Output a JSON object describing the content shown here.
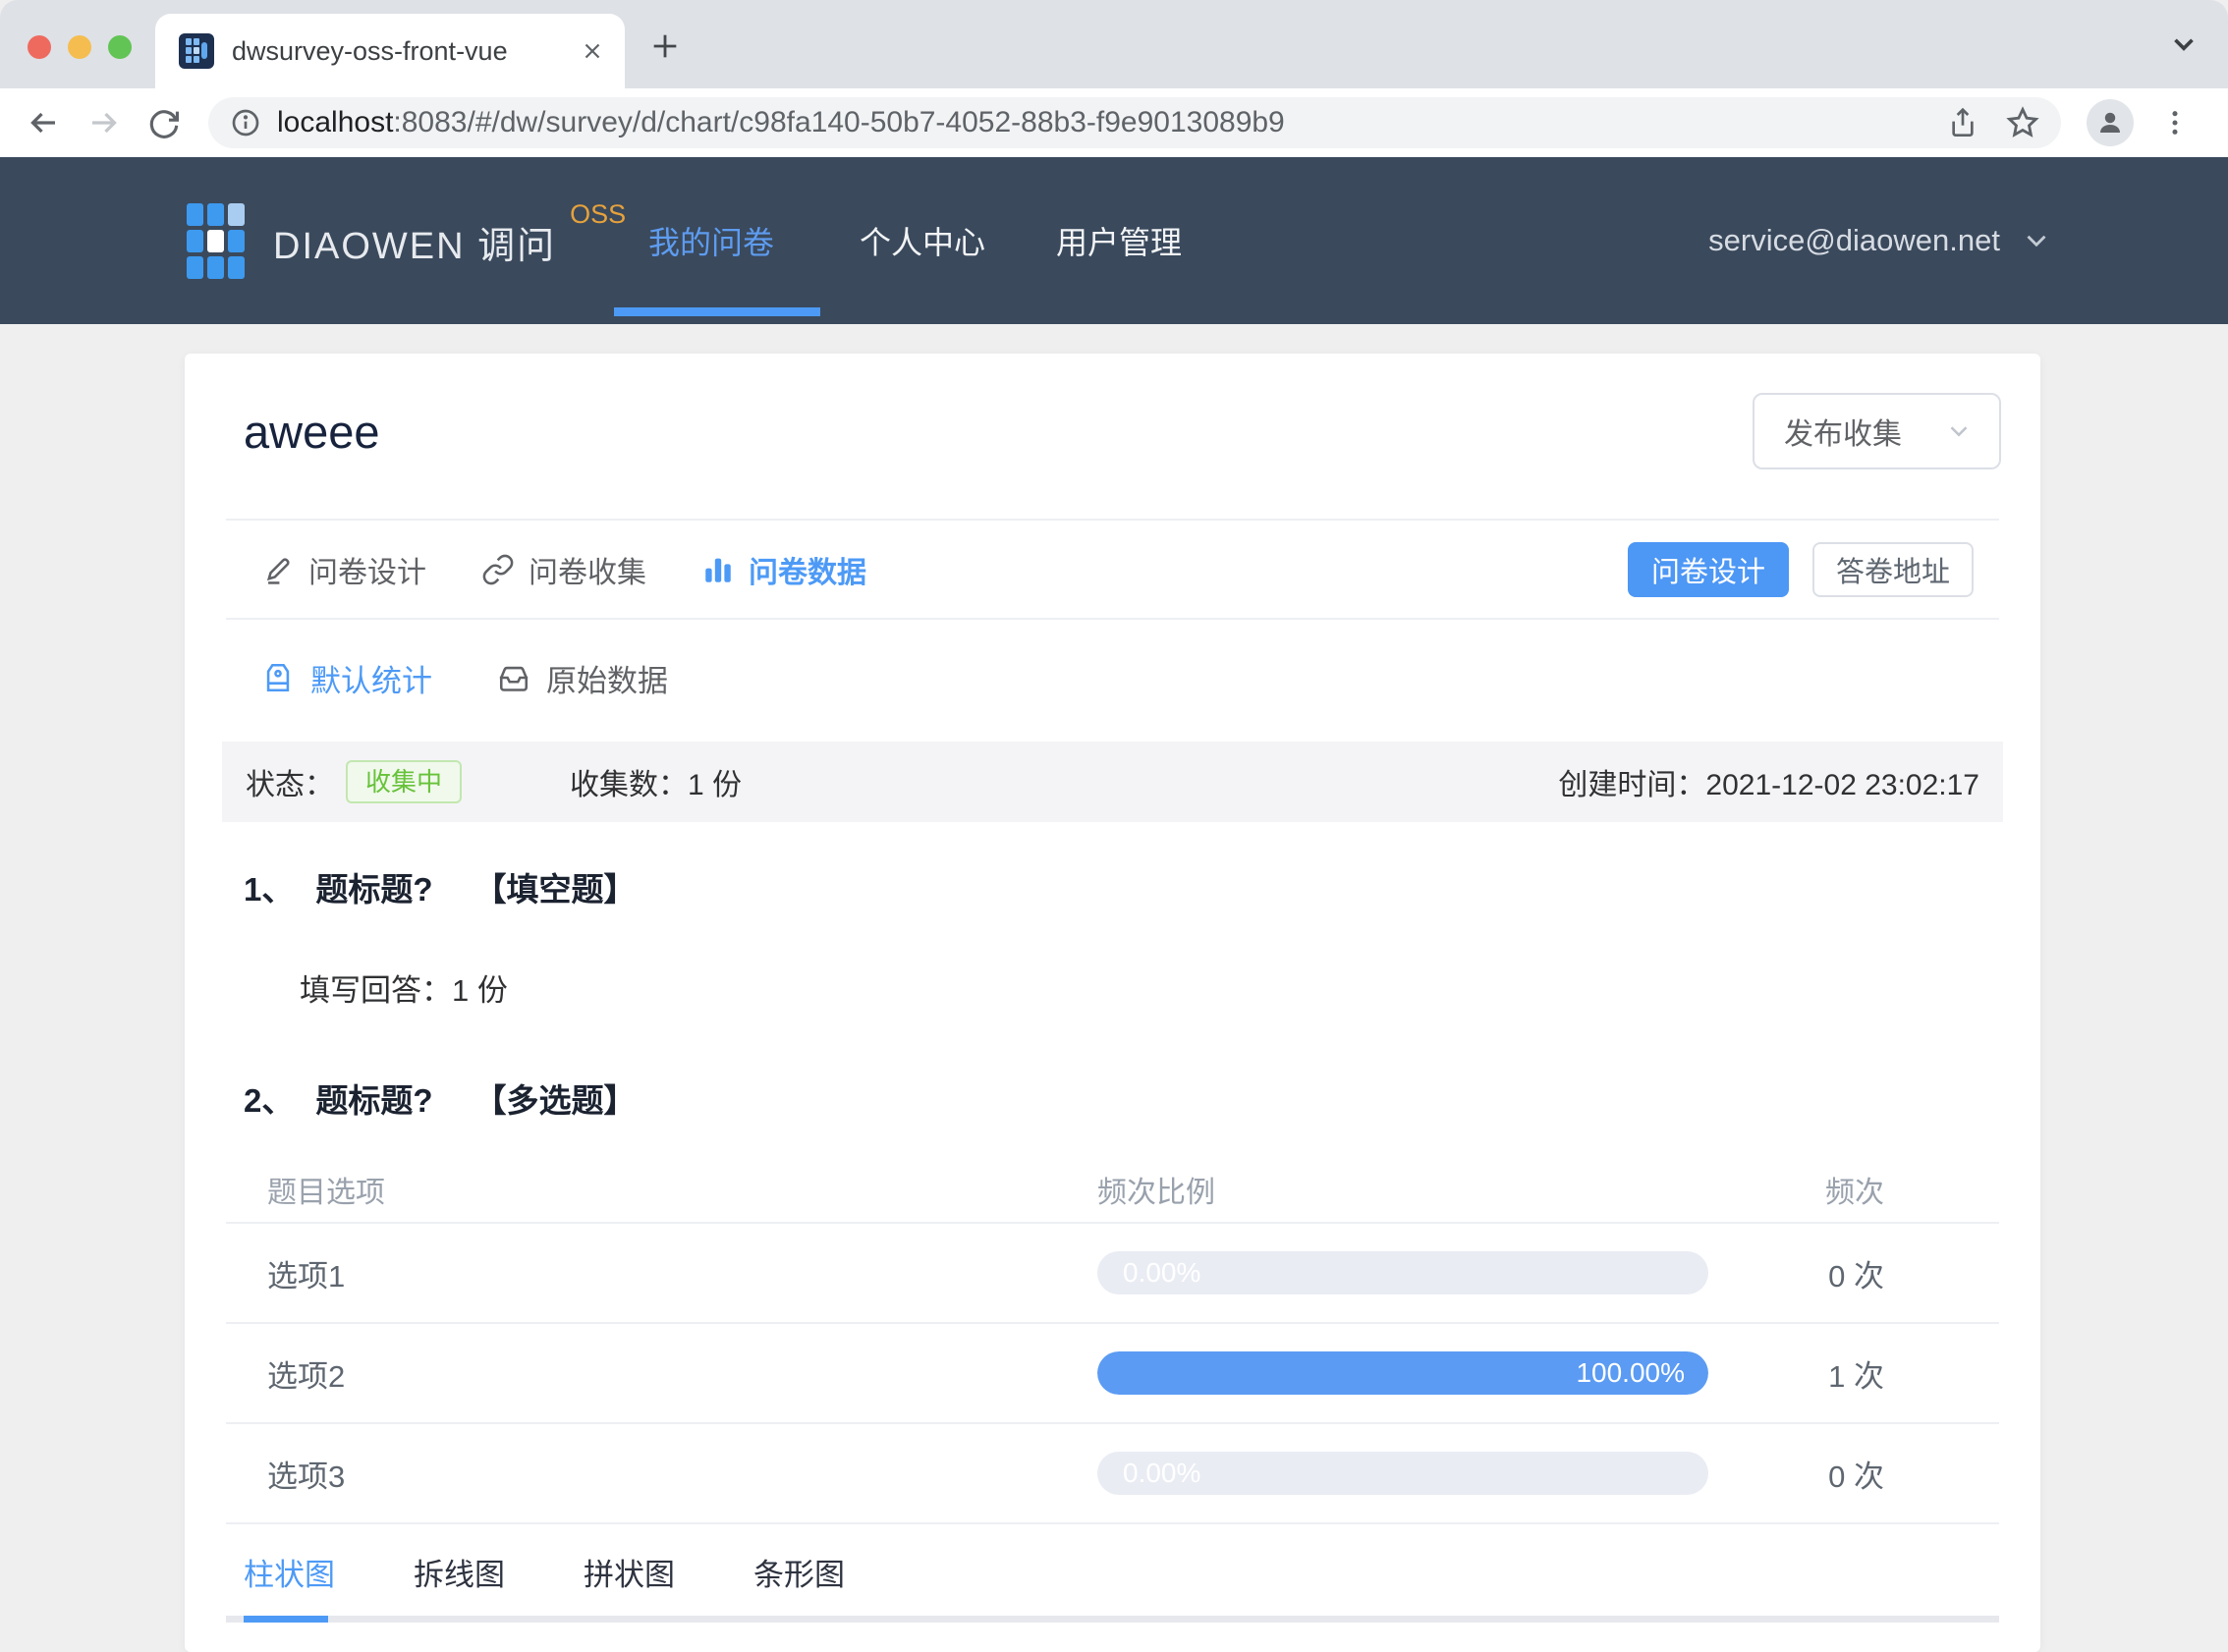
{
  "browser": {
    "tab": {
      "title": "dwsurvey-oss-front-vue",
      "close_glyph": "✕"
    },
    "url": {
      "host": "localhost",
      "path": ":8083/#/dw/survey/d/chart/c98fa140-50b7-4052-88b3-f9e9013089b9"
    }
  },
  "navbar": {
    "brand": {
      "name": "DIAOWEN 调问",
      "badge": "OSS"
    },
    "items": [
      {
        "label": "我的问卷",
        "active": true
      },
      {
        "label": "个人中心",
        "active": false
      },
      {
        "label": "用户管理",
        "active": false
      }
    ],
    "user_email": "service@diaowen.net"
  },
  "survey": {
    "title": "aweee",
    "publish_select_value": "发布收集",
    "detail_tabs": [
      {
        "label": "问卷设计",
        "icon": "pencil-icon",
        "active": false
      },
      {
        "label": "问卷收集",
        "icon": "link-icon",
        "active": false
      },
      {
        "label": "问卷数据",
        "icon": "bar-chart-icon",
        "active": true
      }
    ],
    "actions": {
      "design_button": "问卷设计",
      "answer_url_button": "答卷地址"
    },
    "stat_tabs": [
      {
        "label": "默认统计",
        "icon": "tag-icon",
        "active": true
      },
      {
        "label": "原始数据",
        "icon": "inbox-icon",
        "active": false
      }
    ],
    "status_bar": {
      "status_label": "状态：",
      "status_badge": "收集中",
      "count_label": "收集数：",
      "count_value": "1 份",
      "created_label": "创建时间：",
      "created_value": "2021-12-02 23:02:17"
    },
    "questions": [
      {
        "index": "1、",
        "title": "题标题?",
        "type": "【填空题】",
        "answer_label": "填写回答：",
        "answer_value": "1 份"
      },
      {
        "index": "2、",
        "title": "题标题?",
        "type": "【多选题】"
      }
    ],
    "table": {
      "headers": [
        "题目选项",
        "频次比例",
        "频次"
      ],
      "rows": [
        {
          "option": "选项1",
          "percent": "0.00%",
          "value": 0,
          "count": "0 次"
        },
        {
          "option": "选项2",
          "percent": "100.00%",
          "value": 100,
          "count": "1 次"
        },
        {
          "option": "选项3",
          "percent": "0.00%",
          "value": 0,
          "count": "0 次"
        }
      ]
    },
    "chart_tabs": [
      {
        "label": "柱状图",
        "active": true
      },
      {
        "label": "拆线图",
        "active": false
      },
      {
        "label": "拼状图",
        "active": false
      },
      {
        "label": "条形图",
        "active": false
      }
    ]
  },
  "colors": {
    "accent_blue": "#4D9AF6",
    "bar_fill": "#5B9BF3",
    "bar_track": "#E9ECF3",
    "navbar_bg": "#3A495C",
    "oss_badge": "#E6A23C",
    "success_text": "#67C23A",
    "success_bg": "#F0F9EB",
    "success_border": "#C2E7B0"
  }
}
